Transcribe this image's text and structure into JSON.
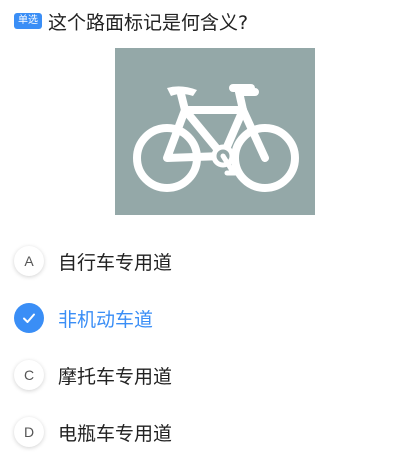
{
  "question": {
    "type_badge": "单选",
    "text": "这个路面标记是何含义?"
  },
  "sign": {
    "description_icon": "bicycle-icon",
    "background_color": "#94a8a8"
  },
  "accent_color": "#3a8ef6",
  "options": [
    {
      "letter": "A",
      "label": "自行车专用道",
      "selected": false
    },
    {
      "letter": "",
      "label": "非机动车道",
      "selected": true
    },
    {
      "letter": "C",
      "label": "摩托车专用道",
      "selected": false
    },
    {
      "letter": "D",
      "label": "电瓶车专用道",
      "selected": false
    }
  ]
}
